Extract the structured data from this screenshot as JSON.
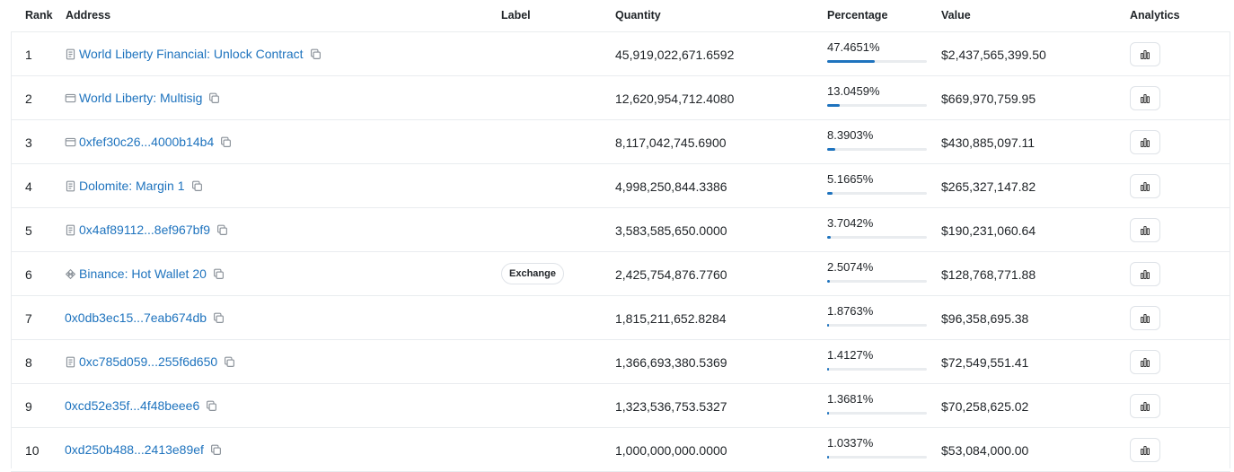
{
  "headers": {
    "rank": "Rank",
    "address": "Address",
    "label": "Label",
    "quantity": "Quantity",
    "percentage": "Percentage",
    "value": "Value",
    "analytics": "Analytics"
  },
  "rows": [
    {
      "rank": "1",
      "icon": "contract-icon",
      "address": "World Liberty Financial: Unlock Contract",
      "label": "",
      "quantity": "45,919,022,671.6592",
      "percentage": "47.4651%",
      "pct": 47.4651,
      "value": "$2,437,565,399.50"
    },
    {
      "rank": "2",
      "icon": "wallet-icon",
      "address": "World Liberty: Multisig",
      "label": "",
      "quantity": "12,620,954,712.4080",
      "percentage": "13.0459%",
      "pct": 13.0459,
      "value": "$669,970,759.95"
    },
    {
      "rank": "3",
      "icon": "wallet-icon",
      "address": "0xfef30c26...4000b14b4",
      "label": "",
      "quantity": "8,117,042,745.6900",
      "percentage": "8.3903%",
      "pct": 8.3903,
      "value": "$430,885,097.11"
    },
    {
      "rank": "4",
      "icon": "contract-icon",
      "address": "Dolomite: Margin 1",
      "label": "",
      "quantity": "4,998,250,844.3386",
      "percentage": "5.1665%",
      "pct": 5.1665,
      "value": "$265,327,147.82"
    },
    {
      "rank": "5",
      "icon": "contract-icon",
      "address": "0x4af89112...8ef967bf9",
      "label": "",
      "quantity": "3,583,585,650.0000",
      "percentage": "3.7042%",
      "pct": 3.7042,
      "value": "$190,231,060.64"
    },
    {
      "rank": "6",
      "icon": "binance-icon",
      "address": "Binance: Hot Wallet 20",
      "label": "Exchange",
      "quantity": "2,425,754,876.7760",
      "percentage": "2.5074%",
      "pct": 2.5074,
      "value": "$128,768,771.88"
    },
    {
      "rank": "7",
      "icon": "",
      "address": "0x0db3ec15...7eab674db",
      "label": "",
      "quantity": "1,815,211,652.8284",
      "percentage": "1.8763%",
      "pct": 1.8763,
      "value": "$96,358,695.38"
    },
    {
      "rank": "8",
      "icon": "contract-icon",
      "address": "0xc785d059...255f6d650",
      "label": "",
      "quantity": "1,366,693,380.5369",
      "percentage": "1.4127%",
      "pct": 1.4127,
      "value": "$72,549,551.41"
    },
    {
      "rank": "9",
      "icon": "",
      "address": "0xcd52e35f...4f48beee6",
      "label": "",
      "quantity": "1,323,536,753.5327",
      "percentage": "1.3681%",
      "pct": 1.3681,
      "value": "$70,258,625.02"
    },
    {
      "rank": "10",
      "icon": "",
      "address": "0xd250b488...2413e89ef",
      "label": "",
      "quantity": "1,000,000,000.0000",
      "percentage": "1.0337%",
      "pct": 1.0337,
      "value": "$53,084,000.00"
    }
  ],
  "colors": {
    "link": "#1e73be",
    "bar": "#1e73be",
    "bar_track": "#e9ecef"
  }
}
